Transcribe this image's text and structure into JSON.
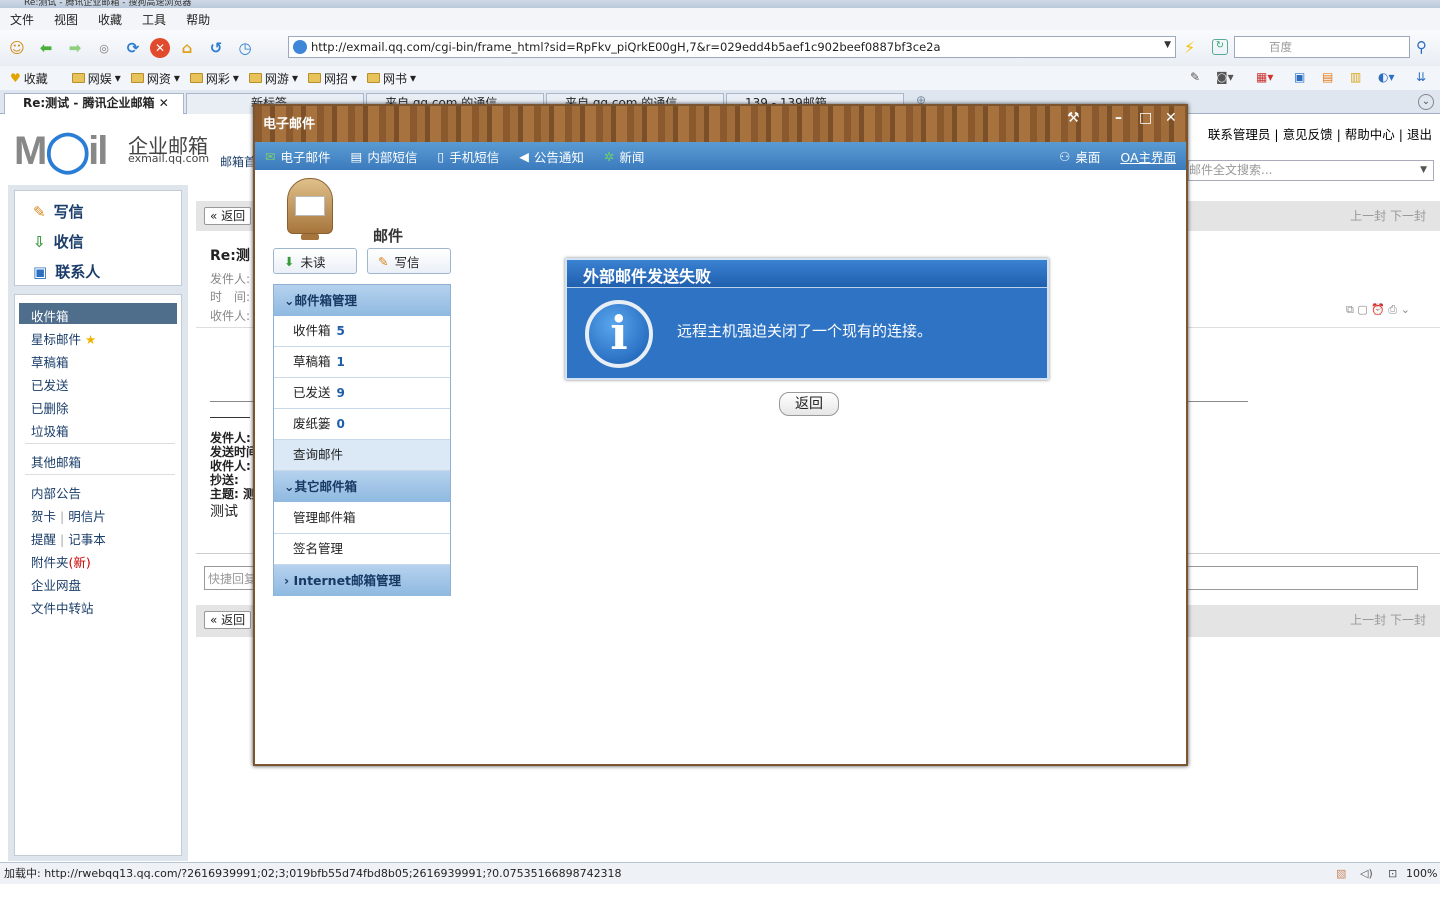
{
  "browser": {
    "title": "Re:测试 - 腾讯企业邮箱 - 搜狗高速浏览器",
    "menu": [
      "文件",
      "视图",
      "收藏",
      "工具",
      "帮助"
    ],
    "url": "http://exmail.qq.com/cgi-bin/frame_html?sid=RpFkv_piQrkE00gH,7&r=029edd4b5aef1c902beef0887bf3ce2a",
    "search_placeholder": "百度",
    "favorites": [
      "收藏",
      "网娱",
      "网资",
      "网彩",
      "网游",
      "网招",
      "网书"
    ],
    "tabs": [
      "Re:测试 - 腾讯企业邮箱",
      "新标签",
      "来自 qq.com 的通信",
      "来自 qq.com 的通信",
      "139 - 139邮箱"
    ],
    "status_text": "加载中: http://rwebqq13.qq.com/?2616939991;02;3;019bfb55d74fbd8b05;2616939991;?0.07535166898742318",
    "zoom": "100%"
  },
  "mail": {
    "logo_text": "企业邮箱",
    "logo_domain": "exmail.qq.com",
    "logo_sub": "邮箱首",
    "top_links": [
      "联系管理员",
      "意见反馈",
      "帮助中心",
      "退出"
    ],
    "search_placeholder": "邮件全文搜索...",
    "quick_actions": [
      "写信",
      "收信",
      "联系人"
    ],
    "folders": [
      "收件箱",
      "星标邮件",
      "草稿箱",
      "已发送",
      "已删除",
      "垃圾箱",
      "其他邮箱",
      "内部公告",
      "贺卡",
      "明信片",
      "提醒",
      "记事本",
      "附件夹",
      "(新)",
      "企业网盘",
      "文件中转站"
    ],
    "back_label": "« 返回",
    "pager": "上一封 下一封",
    "subject": "Re:测",
    "meta_labels": [
      "发件人:",
      "时　间:",
      "收件人:"
    ],
    "quote_labels": [
      "发件人:",
      "发送时间",
      "收件人:",
      "抄送: ",
      "主题: 测"
    ],
    "body_text": "测试",
    "quick_reply": "快捷回复"
  },
  "modal": {
    "title": "电子邮件",
    "nav": [
      "电子邮件",
      "内部短信",
      "手机短信",
      "公告通知",
      "新闻"
    ],
    "nav_right": [
      "桌面",
      "OA主界面"
    ],
    "mail_title": "邮件",
    "unread_btn": "未读",
    "compose_btn": "写信",
    "section1": "邮件箱管理",
    "items": [
      {
        "label": "收件箱",
        "count": "5"
      },
      {
        "label": "草稿箱",
        "count": "1"
      },
      {
        "label": "已发送",
        "count": "9"
      },
      {
        "label": "废纸篓",
        "count": "0"
      },
      {
        "label": "查询邮件",
        "count": ""
      }
    ],
    "section2": "其它邮件箱",
    "items2": [
      "管理邮件箱",
      "签名管理"
    ],
    "section3": "Internet邮箱管理",
    "alert_title": "外部邮件发送失败",
    "alert_message": "远程主机强迫关闭了一个现有的连接。",
    "back_button": "返回"
  }
}
